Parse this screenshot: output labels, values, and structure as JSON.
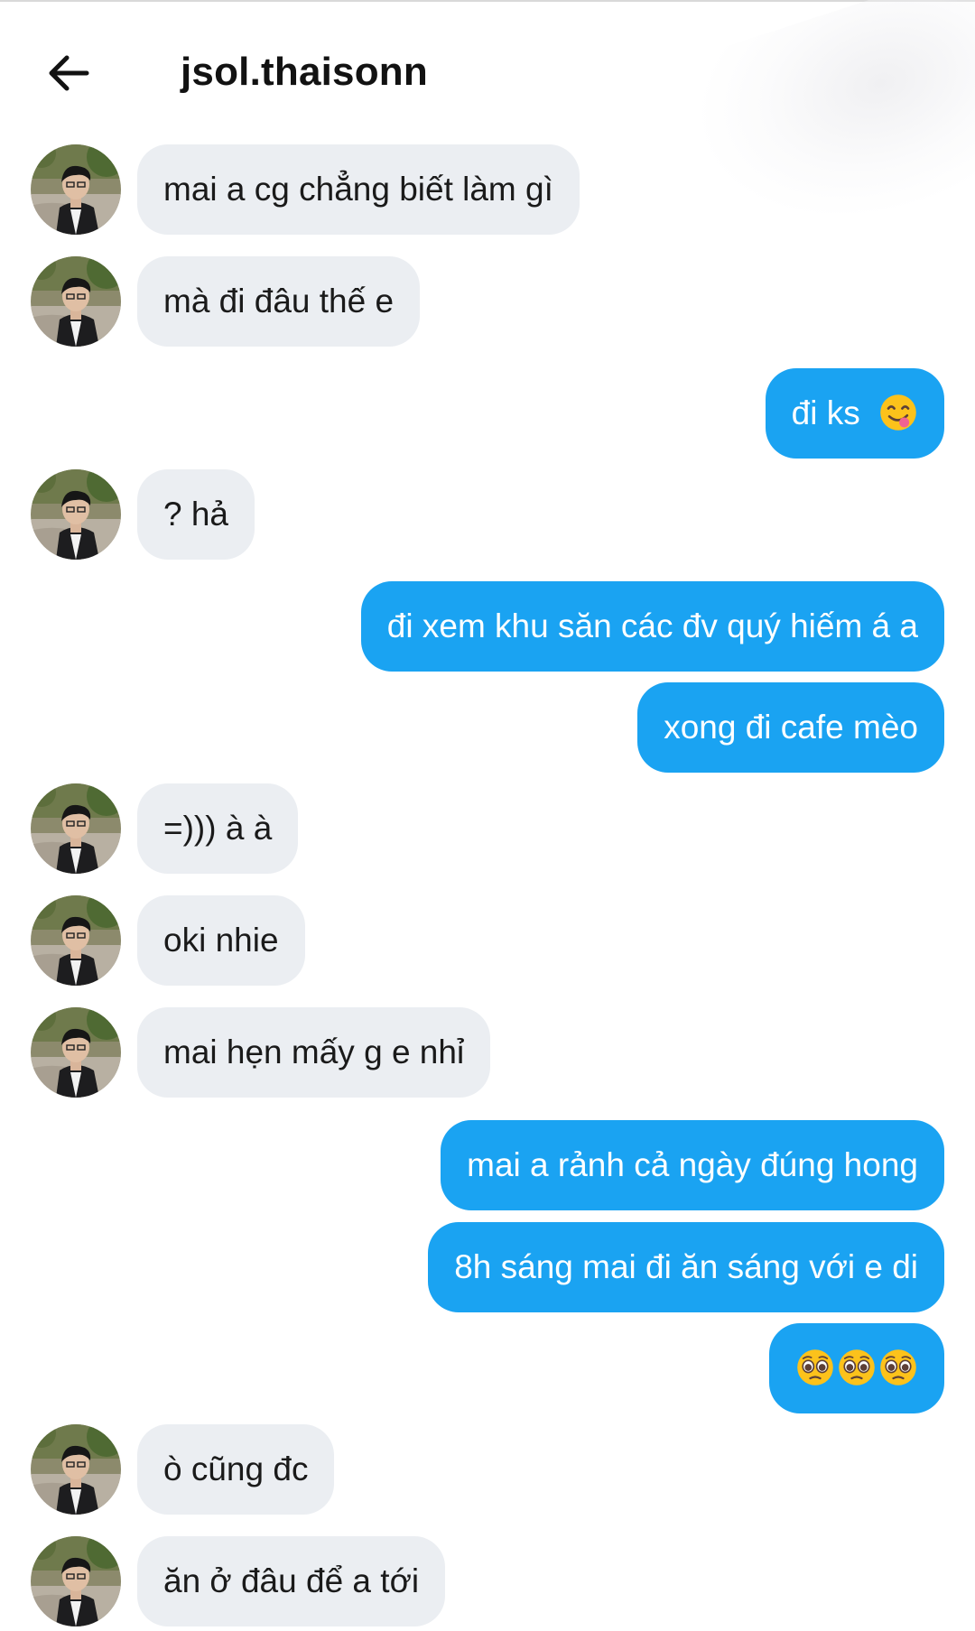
{
  "header": {
    "back_icon": "arrow-left-icon",
    "title": "jsol.thaisonn"
  },
  "colors": {
    "incoming_bubble": "#ebeef2",
    "outgoing_bubble": "#1aa3f2",
    "outgoing_text": "#ffffff"
  },
  "messages": [
    {
      "sender": "them",
      "text": "mai a cg chẳng biết làm gì"
    },
    {
      "sender": "them",
      "text": "mà đi đâu thế e"
    },
    {
      "sender": "me",
      "text": "đi ks",
      "emoji": "yum-face-icon"
    },
    {
      "sender": "them",
      "text": "? hả"
    },
    {
      "sender": "me",
      "text": "đi xem khu săn các đv quý hiếm á a"
    },
    {
      "sender": "me",
      "text": "xong đi cafe mèo"
    },
    {
      "sender": "them",
      "text": "=))) à à"
    },
    {
      "sender": "them",
      "text": "oki nhie"
    },
    {
      "sender": "them",
      "text": "mai hẹn mấy g e nhỉ"
    },
    {
      "sender": "me",
      "text": "mai a rảnh cả ngày đúng hong"
    },
    {
      "sender": "me",
      "text": "8h sáng mai đi ăn sáng với e di"
    },
    {
      "sender": "me",
      "text": "",
      "emoji": "pleading-face-icon",
      "emoji_count": 3
    },
    {
      "sender": "them",
      "text": "ò cũng đc"
    },
    {
      "sender": "them",
      "text": "ăn ở đâu để a tới"
    }
  ]
}
